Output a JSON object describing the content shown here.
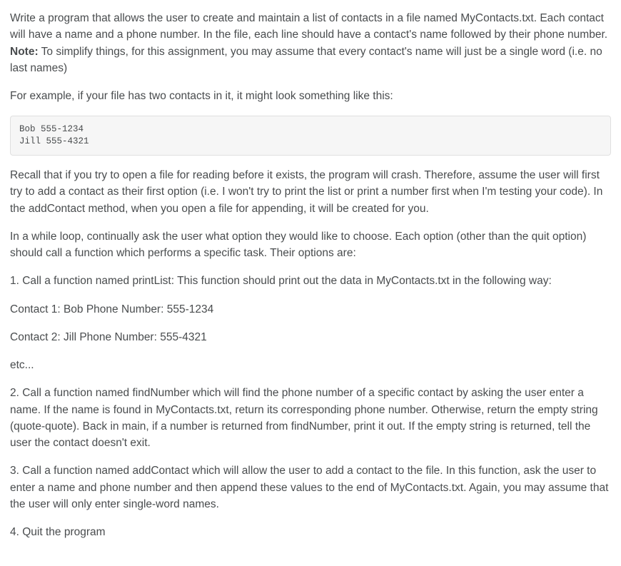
{
  "intro": {
    "p1_a": "Write a program that allows the user to create and maintain a list of contacts in a file named MyContacts.txt. Each contact will have a name and a phone number. In the file, each line should have a contact's name followed by their phone number. ",
    "note_label": "Note:",
    "p1_b": " To simplify things, for this assignment, you may assume that every contact's name will just be a single word (i.e. no last names)",
    "p2": "For example, if your file has two contacts in it, it might look something like this:"
  },
  "code_example": "Bob 555-1234\nJill 555-4321",
  "recall": "Recall that if you try to open a file for reading before it exists, the program will crash. Therefore, assume the user will first try to add a contact as their first option (i.e. I won't try to print the list or print a number first when I'm testing your code). In the addContact method, when you open a file for appending, it will be created for you.",
  "loop_intro": "In a while loop, continually ask the user what option they would like to choose. Each option (other than the quit option) should call a function which performs a specific task. Their options are:",
  "option1": {
    "desc": "1. Call a function named printList: This function should print out the data in MyContacts.txt in the following way:",
    "line1": "Contact 1: Bob Phone Number: 555-1234",
    "line2": "Contact 2: Jill Phone Number: 555-4321",
    "etc": "etc..."
  },
  "option2": "2. Call a function named findNumber which will find the phone number of a specific contact by asking the user enter a name. If the name is found in MyContacts.txt, return its corresponding phone number. Otherwise, return the empty string (quote-quote). Back in main, if a number is returned from findNumber, print it out. If the empty string is returned, tell the user the contact doesn't exit.",
  "option3": "3. Call a function named addContact which will allow the user to add a contact to the file. In this function, ask the user to enter a name and phone number and then append these values to the end of MyContacts.txt. Again, you may assume that the user will only enter single-word names.",
  "option4": "4. Quit the program"
}
